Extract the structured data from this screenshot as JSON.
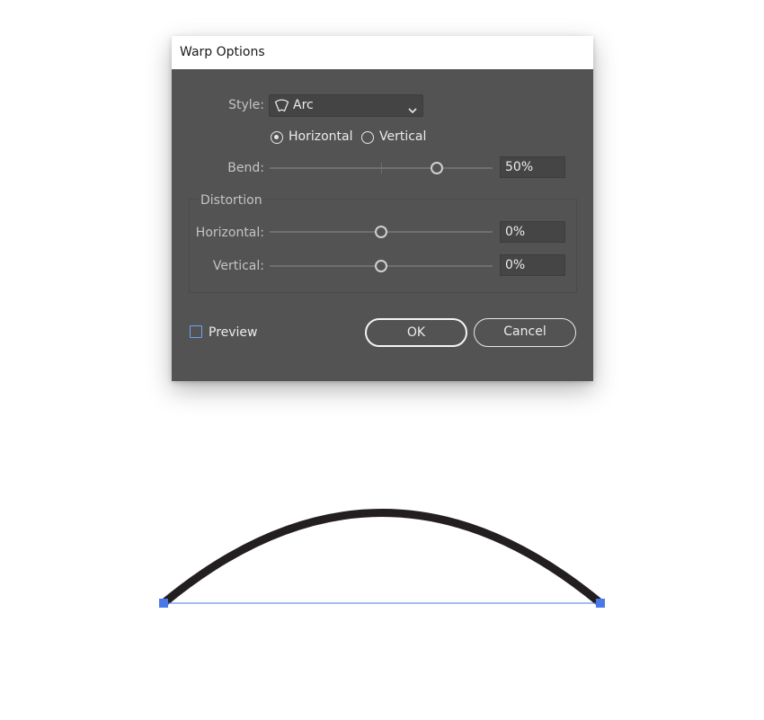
{
  "dialog": {
    "title": "Warp Options",
    "style": {
      "label": "Style:",
      "value": "Arc",
      "icon": "arc-icon"
    },
    "orientation": {
      "horizontal_label": "Horizontal",
      "vertical_label": "Vertical",
      "selected": "Horizontal"
    },
    "bend": {
      "label": "Bend:",
      "value_text": "50%",
      "value": 50
    },
    "distortion": {
      "group_label": "Distortion",
      "horizontal": {
        "label": "Horizontal:",
        "value_text": "0%",
        "value": 0
      },
      "vertical": {
        "label": "Vertical:",
        "value_text": "0%",
        "value": 0
      }
    },
    "preview": {
      "label": "Preview",
      "checked": false
    },
    "buttons": {
      "ok": "OK",
      "cancel": "Cancel"
    }
  },
  "colors": {
    "dialog_bg": "#535353",
    "arc_stroke": "#231f20",
    "selection_blue": "#4a78e8",
    "checkbox_border": "#6ea4f2"
  }
}
